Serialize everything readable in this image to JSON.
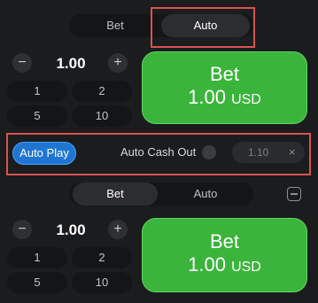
{
  "top": {
    "tabs": [
      {
        "label": "Bet",
        "active": false
      },
      {
        "label": "Auto",
        "active": true
      }
    ],
    "amount": "1.00",
    "minus": "−",
    "plus": "+",
    "quick": [
      "1",
      "2",
      "5",
      "10"
    ],
    "bet_label": "Bet",
    "bet_amount": "1.00",
    "bet_currency": "USD"
  },
  "autobar": {
    "auto_play": "Auto Play",
    "auto_cash_out": "Auto Cash Out",
    "coef": "1.10",
    "clear": "×"
  },
  "bottom": {
    "tabs": [
      {
        "label": "Bet",
        "active": true
      },
      {
        "label": "Auto",
        "active": false
      }
    ],
    "amount": "1.00",
    "minus": "−",
    "plus": "+",
    "quick": [
      "1",
      "2",
      "5",
      "10"
    ],
    "bet_label": "Bet",
    "bet_amount": "1.00",
    "bet_currency": "USD"
  },
  "colors": {
    "bet_green": "#3bb43b",
    "auto_play_blue": "#1f76d2",
    "highlight_red": "#d9534f",
    "background": "#1b1c1e"
  }
}
